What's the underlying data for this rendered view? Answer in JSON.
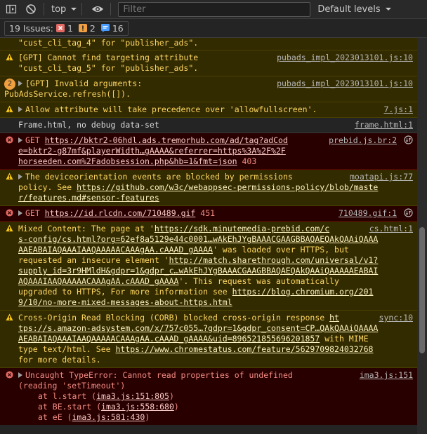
{
  "toolbar": {
    "context": "top",
    "filter_placeholder": "Filter",
    "levels_label": "Default levels"
  },
  "issues": {
    "label": "19 Issues:",
    "errors": "1",
    "warnings": "2",
    "info": "16"
  },
  "colors": {
    "warn": "#fdd663",
    "error": "#f28b82",
    "info_badge": "#4a9dff"
  },
  "messages": {
    "m0": {
      "text": "\"cust_cli_tag_4\" for \"publisher_ads\"."
    },
    "m1": {
      "text1": "[GPT] Cannot find targeting attribute",
      "text2": "\"cust_cli_tag_5\" for \"publisher_ads\".",
      "source": "pubads_impl_2023013101.js:10"
    },
    "m2": {
      "count": "2",
      "text1": "[GPT] Invalid arguments:",
      "text2": "PubAdsService.refresh([]).",
      "source": "pubads_impl_2023013101.js:10"
    },
    "m3": {
      "text": "Allow attribute will take precedence over 'allowfullscreen'.",
      "source": "7.js:1"
    },
    "m4": {
      "text": "Frame.html, no debug data-set",
      "source": "frame.html:1"
    },
    "m5": {
      "method": "GET",
      "url1": "https://bktr2-06hdl.ads.tremorhub.com/ad/tag?adCod",
      "url2": "e=bktr2-g87mf&playerWidth…gAAAA&referrer=https%3A%2F%2F",
      "url3": "horseeden.com%2Fadobsession.php&hb=1&fmt=json",
      "status": "403",
      "source": "prebid.js.br:2"
    },
    "m6": {
      "text1": "The deviceorientation events are blocked by permissions",
      "text2a": "policy. See ",
      "url1": "https://github.com/w3c/webappsec-permissions-policy/blob/maste",
      "url2": "r/features.md#sensor-features",
      "source": "moatapi.js:77"
    },
    "m7": {
      "method": "GET",
      "url": "https://id.rlcdn.com/710489.gif",
      "status": "451",
      "source": "710489.gif:1"
    },
    "m8": {
      "t1": "Mixed Content: The page at '",
      "u1": "https://sdk.minutemedia-prebid.com/c",
      "u2": "s-config/cs.html?org=62ef8a5129e44c0001…wAkEhJYgBAAACGAAGBBAQAEQAkQAAiQAAA",
      "u3": "AAEABAIAQAAAIAAQAAAAACAAAgAA.cAAAD_gAAAA",
      "t2": "' was loaded over HTTPS, but",
      "t3": "requested an insecure element '",
      "u4": "http://match.sharethrough.com/universal/v1?",
      "u5": "supply_id=3r9HMldH&gdpr=1&gdpr_c…wAkEhJYgBAAACGAAGBBAQAEQAkQAAiQAAAAAEABAI",
      "u6": "AQAAAIAAQAAAAACAAAgAA.cAAAD_gAAAA",
      "t4": "'. This request was automatically",
      "t5": "upgraded to HTTPS, For more information see ",
      "u7": "https://blog.chromium.org/201",
      "u8": "9/10/no-more-mixed-messages-about-https.html",
      "source": "cs.html:1"
    },
    "m9": {
      "t1": "Cross-Origin Read Blocking (CORB) blocked cross-origin response ",
      "u1": "ht",
      "u2": "tps://s.amazon-adsystem.com/x/757c055…?gdpr=1&gdpr_consent=CP…QAkQAAiQAAAA",
      "u3": "AEABAIAQAAAIAAQAAAAACAAAgAA.cAAAD_gAAAA&uid=896521855696201857",
      "t2": " with MIME",
      "t3": "type text/html. See ",
      "u4": "https://www.chromestatus.com/feature/5629709824032768",
      "t4": "for more details.",
      "source": "sync:10"
    },
    "m10": {
      "t1": "Uncaught TypeError: Cannot read properties of undefined",
      "t2": "(reading 'setTimeout')",
      "s1a": "at l.start (",
      "s1b": "ima3.js:151:805",
      "s1c": ")",
      "s2a": "at BE.start (",
      "s2b": "ima3.js:558:680",
      "s2c": ")",
      "s3a": "at eE (",
      "s3b": "ima3.js:581:430",
      "s3c": ")",
      "source": "ima3.js:151"
    }
  }
}
